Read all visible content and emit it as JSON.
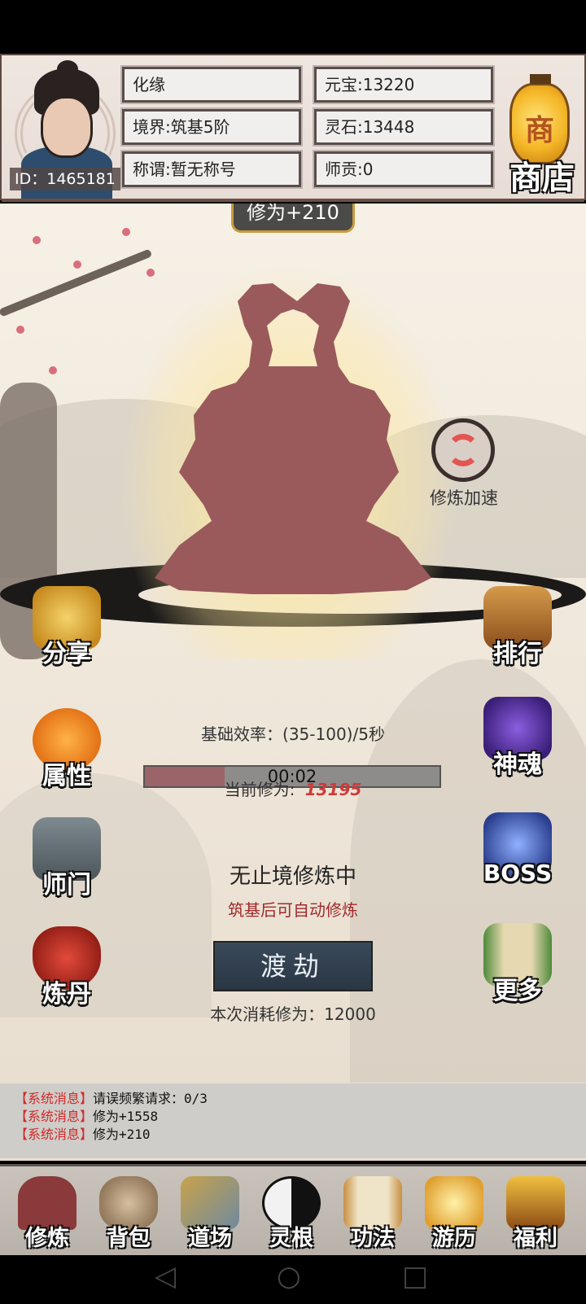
{
  "player": {
    "id_text": "ID：1465181",
    "action": "化缘",
    "realm": "境界:筑基5阶",
    "title": "称谓:暂无称号",
    "yuanbao": "元宝:13220",
    "lingshi": "灵石:13448",
    "shigong": "师贡:0"
  },
  "shop": {
    "lantern_char": "商",
    "label": "商店"
  },
  "cultivation_gain": "修为+210",
  "speedup_label": "修炼加速",
  "side_left": [
    {
      "label": "分享",
      "icon": "fist-gold-icon"
    },
    {
      "label": "属性",
      "icon": "orange-spirit-icon"
    },
    {
      "label": "师门",
      "icon": "gate-icon"
    },
    {
      "label": "炼丹",
      "icon": "gourd-icon"
    }
  ],
  "side_right": [
    {
      "label": "排行",
      "icon": "ranking-scroll-icon"
    },
    {
      "label": "神魂",
      "icon": "purple-soul-icon"
    },
    {
      "label": "BOSS",
      "icon": "boss-dragon-icon"
    },
    {
      "label": "更多",
      "icon": "scroll-icon"
    }
  ],
  "stats": {
    "base_rate": "基础效率：(35-100)/5秒",
    "timer": "00:02",
    "progress_fraction": 0.27,
    "current_label": "当前修为:",
    "current_value": "13195",
    "mode": "无止境修炼中",
    "hint": "筑基后可自动修炼",
    "dujie_button": "渡劫",
    "cost": "本次消耗修为：12000"
  },
  "log": [
    {
      "tag": "【系统消息】",
      "text": "请误频繁请求：0/3"
    },
    {
      "tag": "【系统消息】",
      "text": "修为+1558"
    },
    {
      "tag": "【系统消息】",
      "text": "修为+210"
    }
  ],
  "bottom_nav": [
    {
      "label": "修炼",
      "icon": "meditator-icon"
    },
    {
      "label": "背包",
      "icon": "bag-icon"
    },
    {
      "label": "道场",
      "icon": "dojo-icon"
    },
    {
      "label": "灵根",
      "icon": "yin-yang-icon"
    },
    {
      "label": "功法",
      "icon": "technique-scroll-icon"
    },
    {
      "label": "游历",
      "icon": "map-icon"
    },
    {
      "label": "福利",
      "icon": "treasure-chest-icon"
    }
  ],
  "colors": {
    "silhouette": "#9a5a5c",
    "log_tag": "#d12a2a",
    "current_value": "#d03a3a"
  }
}
